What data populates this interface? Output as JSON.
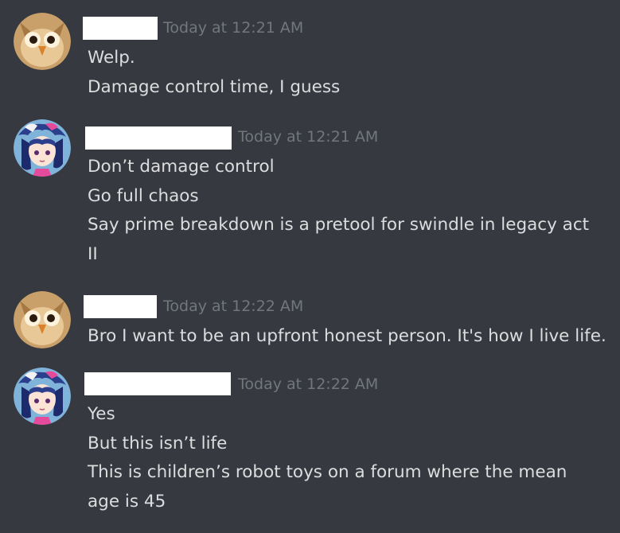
{
  "messages": [
    {
      "author": "owl",
      "avatar": "owl-avatar",
      "timestamp": "Today at 12:21 AM",
      "lines": [
        "Welp.",
        "Damage control time, I guess"
      ]
    },
    {
      "author": "anime",
      "avatar": "anime-character-avatar",
      "timestamp": "Today at 12:21 AM",
      "lines": [
        "Don’t damage control",
        "Go full chaos",
        "Say prime breakdown is a pretool for swindle in legacy act",
        "II"
      ]
    },
    {
      "author": "owl",
      "avatar": "owl-avatar",
      "timestamp": "Today at 12:22 AM",
      "lines": [
        "Bro I want to be an upfront honest person. It's how I live life."
      ]
    },
    {
      "author": "anime",
      "avatar": "anime-character-avatar",
      "timestamp": "Today at 12:22 AM",
      "lines": [
        "Yes",
        "But this isn’t life",
        "This is children’s robot toys on a forum where the mean",
        "age is 45"
      ]
    }
  ],
  "colors": {
    "background": "#36393f",
    "message_text": "#dcddde",
    "timestamp": "#72767d",
    "redaction": "#ffffff"
  }
}
